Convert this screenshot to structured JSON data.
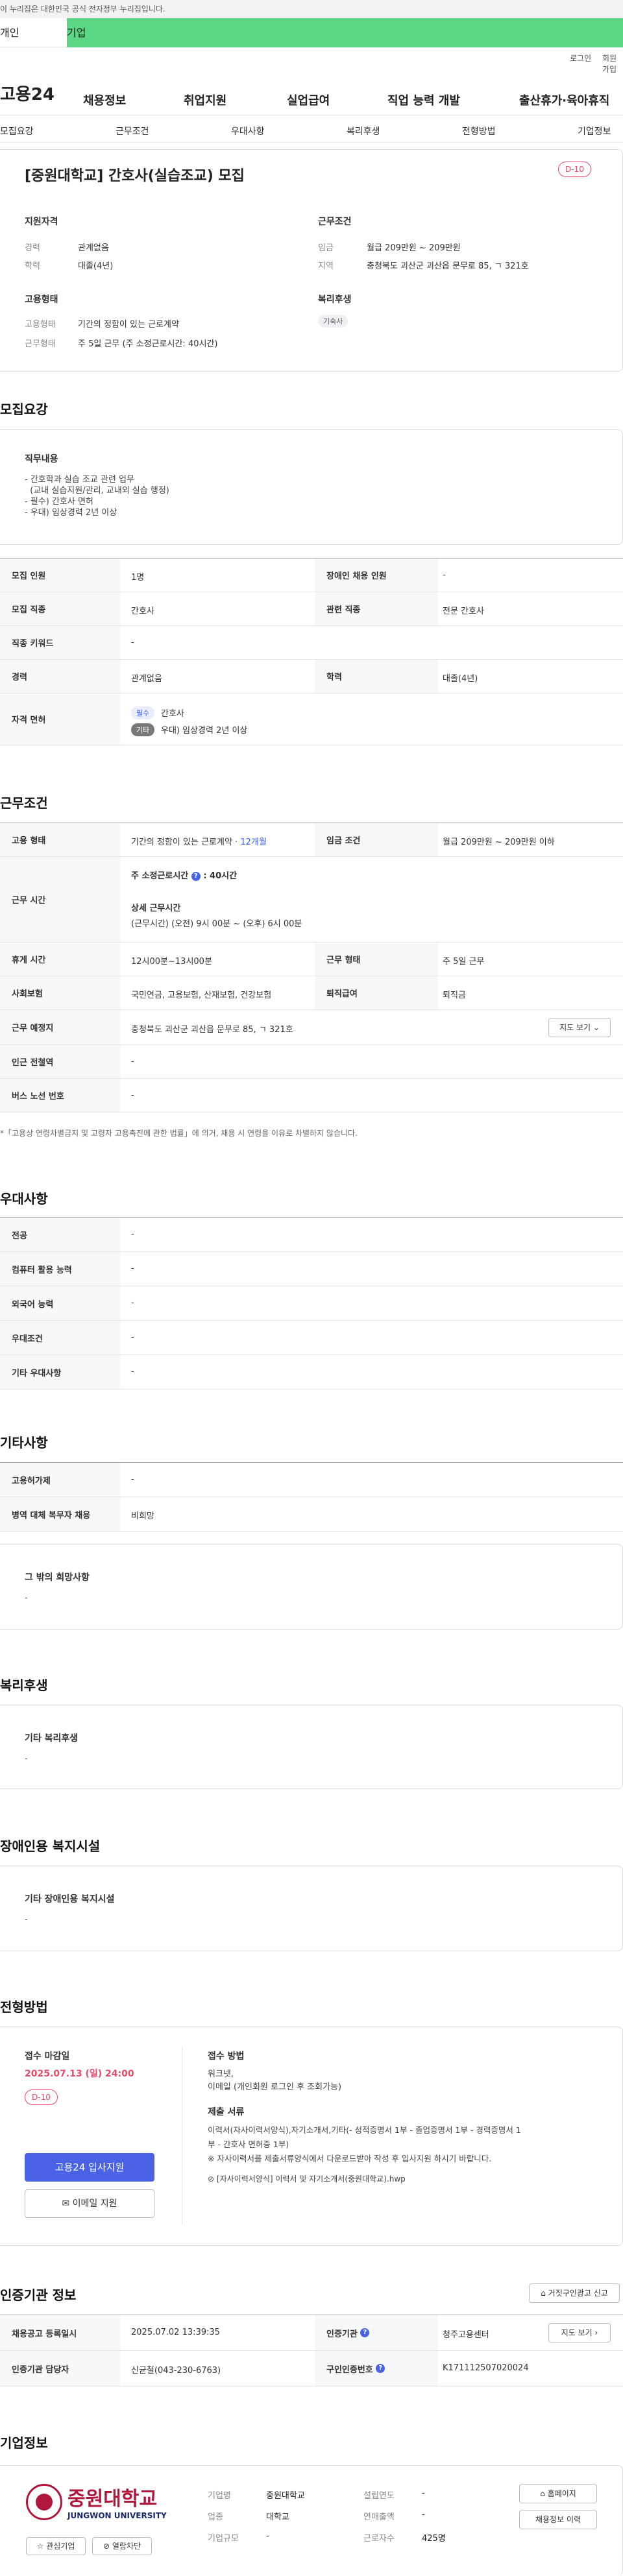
{
  "gov_bar": "이 누리집은 대한민국 공식 전자정부 누리집입니다.",
  "tabs": {
    "person": "개인",
    "company": "기업"
  },
  "util": {
    "login": "로그인",
    "join": "회원가입"
  },
  "gnb": {
    "logo": "고용24",
    "menu": [
      "채용정보",
      "취업지원",
      "실업급여",
      "직업 능력 개발",
      "출산휴가·육아휴직"
    ]
  },
  "subnav": [
    "모집요강",
    "근무조건",
    "우대사항",
    "복리후생",
    "전형방법",
    "기업정보"
  ],
  "summary": {
    "title": "[중원대학교] 간호사(실습조교) 모집",
    "dday": "D-10",
    "qual_title": "지원자격",
    "career_k": "경력",
    "career_v": "관계없음",
    "edu_k": "학력",
    "edu_v": "대졸(4년)",
    "cond_title": "근무조건",
    "wage_k": "임금",
    "wage_v": "월급 209만원 ~ 209만원",
    "area_k": "지역",
    "area_v": "충청북도 괴산군 괴산읍 문무로 85, ㄱ 321호",
    "emp_title": "고용형태",
    "emptype_k": "고용형태",
    "emptype_v": "기간의 정함이 있는 근로계약",
    "worktype_k": "근무형태",
    "worktype_v": "주 5일 근무 (주 소정근로시간: 40시간)",
    "welfare_title": "복리후생",
    "welfare_pill": "기숙사"
  },
  "recruit": {
    "title": "모집요강",
    "duty_title": "직무내용",
    "duty_lines": [
      "- 간호학과 실습 조교 관련 업무",
      "  (교내 실습지원/관리, 교내외 실습 행정)",
      "- 필수) 간호사 면허",
      "- 우대) 임상경력 2년 이상"
    ],
    "rows": {
      "count_k": "모집 인원",
      "count_v": "1명",
      "disabled_k": "장애인 채용 인원",
      "disabled_v": "-",
      "job_k": "모집 직종",
      "job_v": "간호사",
      "related_k": "관련 직종",
      "related_v": "전문 간호사",
      "keyword_k": "직종 키워드",
      "keyword_v": "-",
      "career_k": "경력",
      "career_v": "관계없음",
      "edu_k": "학력",
      "edu_v": "대졸(4년)",
      "license_k": "자격 면허",
      "license_tag1": "필수",
      "license_v1": "간호사",
      "license_tag2": "기타",
      "license_v2": "우대) 임상경력 2년 이상"
    }
  },
  "work": {
    "title": "근무조건",
    "emp_k": "고용 형태",
    "emp_v": "기간의 정함이 있는 근로계약 · ",
    "emp_months": "12개월",
    "wage_k": "임금 조건",
    "wage_v": "월급 209만원 ~ 209만원 이하",
    "hours_k": "근무 시간",
    "hours_main_label": "주 소정근로시간",
    "hours_main_value": ": 40시간",
    "hours_detail_title": "상세 근무시간",
    "hours_detail": "(근무시간) (오전) 9시 00분 ~ (오후) 6시 00분",
    "break_k": "휴게 시간",
    "break_v": "12시00분~13시00분",
    "form_k": "근무 형태",
    "form_v": "주 5일 근무",
    "insurance_k": "사회보험",
    "insurance_v": "국민연금, 고용보험, 산재보험, 건강보험",
    "severance_k": "퇴직급여",
    "severance_v": "퇴직금",
    "place_k": "근무 예정지",
    "place_v": "충청북도 괴산군 괴산읍 문무로 85, ㄱ 321호",
    "map_btn": "지도 보기",
    "station_k": "인근 전철역",
    "station_v": "-",
    "bus_k": "버스 노선 번호",
    "bus_v": "-",
    "note": "*「고용상 연령차별금지 및 고령자 고용촉진에 관한 법률」에 의거, 채용 시 연령을 이유로 차별하지 않습니다."
  },
  "pref": {
    "title": "우대사항",
    "major_k": "전공",
    "major_v": "-",
    "pc_k": "컴퓨터 활용 능력",
    "pc_v": "-",
    "lang_k": "외국어 능력",
    "lang_v": "-",
    "cond_k": "우대조건",
    "cond_v": "-",
    "etc_k": "기타 우대사항",
    "etc_v": "-"
  },
  "other": {
    "title": "기타사항",
    "permit_k": "고용허가제",
    "permit_v": "-",
    "military_k": "병역 대체 복무자 채용",
    "military_v": "비희망",
    "hope_title": "그 밖의 희망사항",
    "hope_v": "-"
  },
  "welfare": {
    "title": "복리후생",
    "box_title": "기타 복리후생",
    "box_v": "-"
  },
  "facility": {
    "title": "장애인용 복지시설",
    "box_title": "기타 장애인용 복지시설",
    "box_v": "-"
  },
  "apply": {
    "title": "전형방법",
    "deadline_title": "접수 마감일",
    "deadline": "2025.07.13 (일) 24:00",
    "dday": "D-10",
    "method_title": "접수 방법",
    "method_lines": [
      "워크넷,",
      "이메일 (개인회원 로그인 후 조회가능)"
    ],
    "docs_title": "제출 서류",
    "docs_lines": [
      "이력서(자사이력서양식),자기소개서,기타(- 성적증명서 1부 - 졸업증명서 1부 - 경력증명서 1",
      "부 - 간호사 면허증 1부)",
      "※ 자사이력서를 제출서류양식에서 다운로드받아 작성 후 입사지원 하시기 바랍니다."
    ],
    "file_link": "[자사이력서양식] 이력서 및 자기소개서(중원대학교).hwp",
    "apply_btn": "고용24 입사지원",
    "email_btn": "이메일 지원"
  },
  "agency": {
    "title": "인증기관 정보",
    "report_btn": "거짓구인광고 신고",
    "reg_k": "채용공고 등록일시",
    "reg_v": "2025.07.02 13:39:35",
    "org_k": "인증기관",
    "org_v": "청주고용센터",
    "map_btn": "지도 보기",
    "mgr_k": "인증기관 담당자",
    "mgr_v": "신균철(043-230-6763)",
    "num_k": "구인인증번호",
    "num_v": "K171112507020024"
  },
  "company": {
    "title": "기업정보",
    "logo_ko": "중원대학교",
    "logo_en": "JUNGWON UNIVERSITY",
    "name_k": "기업명",
    "name_v": "중원대학교",
    "industry_k": "업종",
    "industry_v": "대학교",
    "scale_k": "기업규모",
    "scale_v": "-",
    "est_k": "설립연도",
    "est_v": "-",
    "sales_k": "연매출액",
    "sales_v": "-",
    "emp_k": "근로자수",
    "emp_v": "425명",
    "home_btn": "홈페이지",
    "history_btn": "채용정보 이력",
    "fav_btn": "관심기업",
    "block_btn": "열람차단"
  }
}
